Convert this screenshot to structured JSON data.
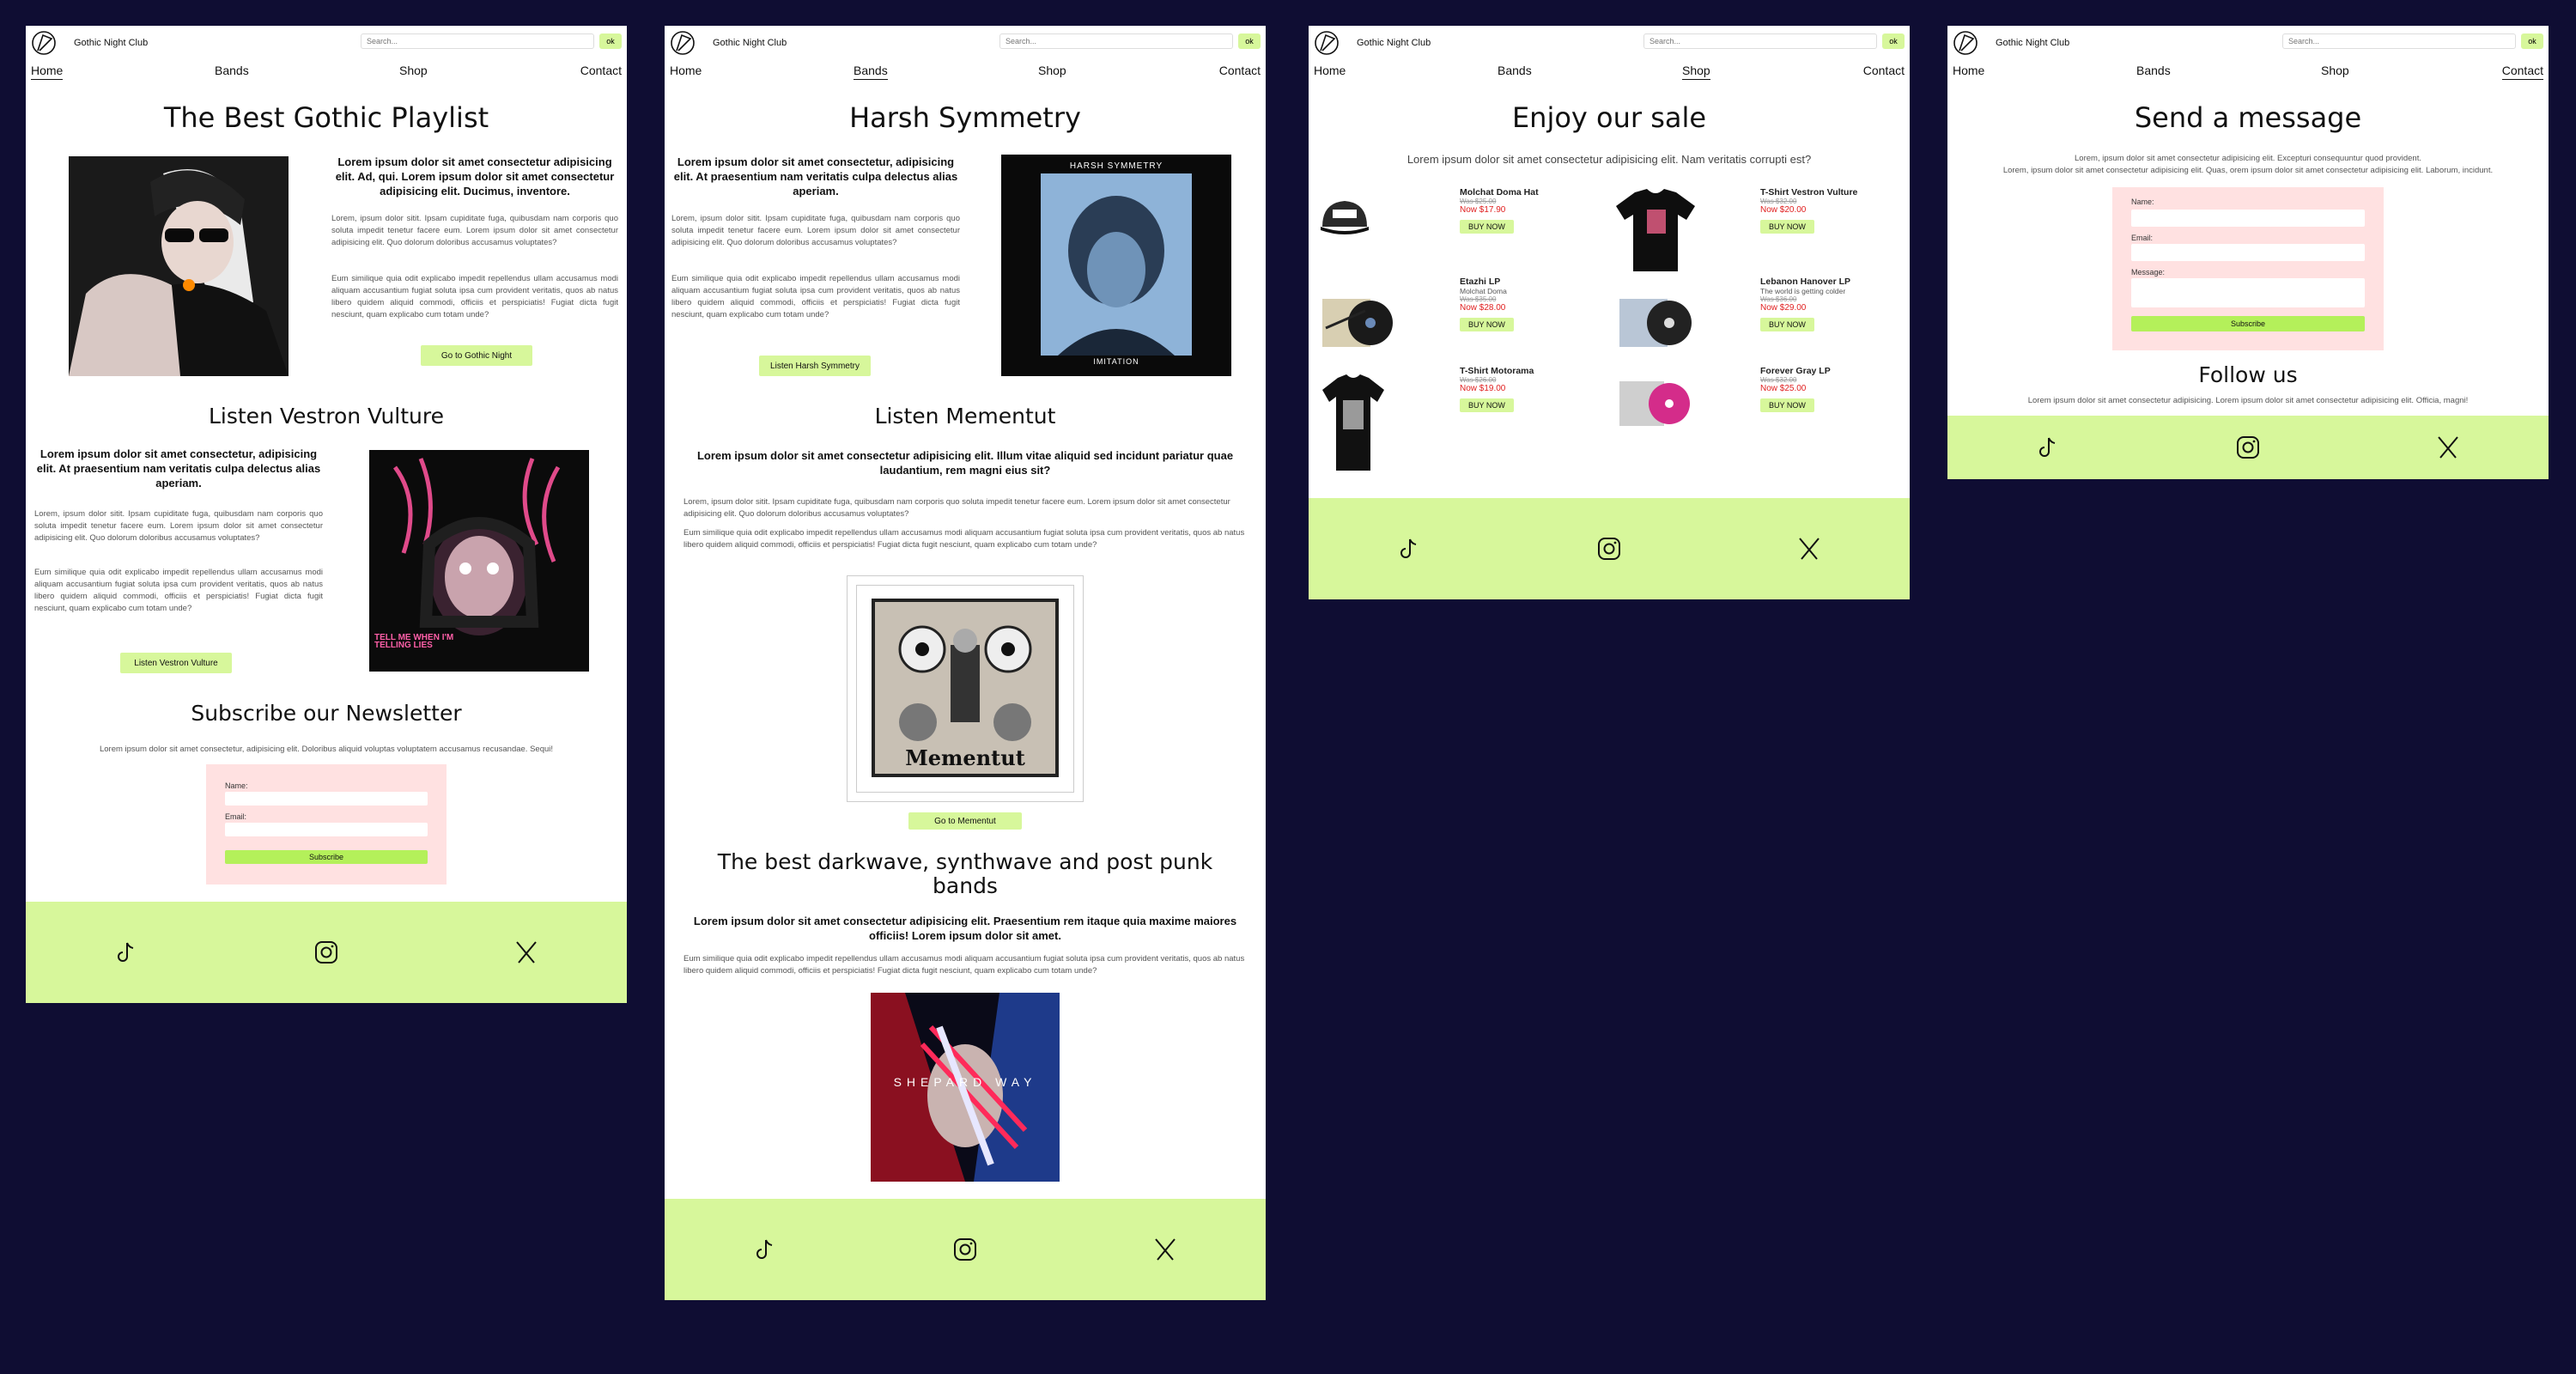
{
  "site": {
    "brand": "Gothic Night Club",
    "search_placeholder": "Search...",
    "search_button": "ok",
    "nav": [
      "Home",
      "Bands",
      "Shop",
      "Contact"
    ]
  },
  "home": {
    "title": "The Best Gothic Playlist",
    "lead1": "Lorem ipsum dolor sit amet consectetur adipisicing elit. Ad, qui. Lorem ipsum dolor sit amet consectetur adipisicing elit. Ducimus, inventore.",
    "p1": "Lorem, ipsum dolor sitit. Ipsam cupiditate fuga, quibusdam nam corporis quo soluta impedit tenetur facere eum. Lorem ipsum dolor sit amet consectetur adipisicing elit. Quo dolorum doloribus accusamus voluptates?",
    "p2": "Eum similique quia odit explicabo impedit repellendus ullam accusamus modi aliquam accusantium fugiat soluta ipsa cum provident veritatis, quos ab natus libero quidem aliquid commodi, officiis et perspiciatis! Fugiat dicta fugit nesciunt, quam explicabo cum totam unde?",
    "btn1": "Go to Gothic Night",
    "h2": "Listen Vestron Vulture",
    "lead2": "Lorem ipsum dolor sit amet consectetur, adipisicing elit. At praesentium nam veritatis culpa delectus alias aperiam.",
    "p3": "Lorem, ipsum dolor sitit. Ipsam cupiditate fuga, quibusdam nam corporis quo soluta impedit tenetur facere eum. Lorem ipsum dolor sit amet consectetur adipisicing elit. Quo dolorum doloribus accusamus voluptates?",
    "p4": "Eum similique quia odit explicabo impedit repellendus ullam accusamus modi aliquam accusantium fugiat soluta ipsa cum provident veritatis, quos ab natus libero quidem aliquid commodi, officiis et perspiciatis! Fugiat dicta fugit nesciunt, quam explicabo cum totam unde?",
    "btn2": "Listen Vestron Vulture",
    "album_text": "TELL ME WHEN I'M TELLING LIES",
    "h3": "Subscribe our Newsletter",
    "p5": "Lorem ipsum dolor sit amet consectetur, adipisicing elit. Doloribus aliquid voluptas voluptatem accusamus recusandae. Sequi!",
    "name_label": "Name:",
    "email_label": "Email:",
    "subscribe": "Subscribe"
  },
  "bands": {
    "title": "Harsh Symmetry",
    "lead1": "Lorem ipsum dolor sit amet consectetur, adipisicing elit. At praesentium nam veritatis culpa delectus alias aperiam.",
    "p1": "Lorem, ipsum dolor sitit. Ipsam cupiditate fuga, quibusdam nam corporis quo soluta impedit tenetur facere eum. Lorem ipsum dolor sit amet consectetur adipisicing elit. Quo dolorum doloribus accusamus voluptates?",
    "p2": "Eum similique quia odit explicabo impedit repellendus ullam accusamus modi aliquam accusantium fugiat soluta ipsa cum provident veritatis, quos ab natus libero quidem aliquid commodi, officiis et perspiciatis! Fugiat dicta fugit nesciunt, quam explicabo cum totam unde?",
    "btn1": "Listen Harsh Symmetry",
    "cover1_top": "HARSH SYMMETRY",
    "cover1_bottom": "IMITATION",
    "h2": "Listen Mementut",
    "lead2": "Lorem ipsum dolor sit amet consectetur adipisicing elit. Illum vitae aliquid sed incidunt pariatur quae laudantium, rem magni eius sit?",
    "p3": "Lorem, ipsum dolor sitit. Ipsam cupiditate fuga, quibusdam nam corporis quo soluta impedit tenetur facere eum. Lorem ipsum dolor sit amet consectetur adipisicing elit. Quo dolorum doloribus accusamus voluptates?",
    "p4": "Eum similique quia odit explicabo impedit repellendus ullam accusamus modi aliquam accusantium fugiat soluta ipsa cum provident veritatis, quos ab natus libero quidem aliquid commodi, officiis et perspiciatis! Fugiat dicta fugit nesciunt, quam explicabo cum totam unde?",
    "cover2_text": "Mementut",
    "btn2": "Go to Mementut",
    "h3": "The best darkwave, synthwave and post punk bands",
    "lead3": "Lorem ipsum dolor sit amet consectetur adipisicing elit. Praesentium rem itaque quia maxime maiores officiis! Lorem ipsum dolor sit amet.",
    "p5": "Eum similique quia odit explicabo impedit repellendus ullam accusamus modi aliquam accusantium fugiat soluta ipsa cum provident veritatis, quos ab natus libero quidem aliquid commodi, officiis et perspiciatis! Fugiat dicta fugit nesciunt, quam explicabo cum totam unde?",
    "cover3_text": "SHEPARD WAY"
  },
  "shop": {
    "title": "Enjoy our sale",
    "subtitle": "Lorem ipsum dolor sit amet consectetur adipisicing elit. Nam veritatis corrupti est?",
    "buy": "BUY NOW",
    "products": [
      {
        "name": "Molchat Doma Hat",
        "sub": "",
        "was": "Was $25.00",
        "now": "Now $17.90"
      },
      {
        "name": "T-Shirt Vestron Vulture",
        "sub": "",
        "was": "Was $32.00",
        "now": "Now $20.00"
      },
      {
        "name": "Etazhi LP",
        "sub": "Molchat Doma",
        "was": "Was $35.00",
        "now": "Now $28.00"
      },
      {
        "name": "Lebanon Hanover LP",
        "sub": "The world is getting colder",
        "was": "Was $36.00",
        "now": "Now $29.00"
      },
      {
        "name": "T-Shirt Motorama",
        "sub": "",
        "was": "Was $26.00",
        "now": "Now $19.00"
      },
      {
        "name": "Forever Gray LP",
        "sub": "",
        "was": "Was $32.00",
        "now": "Now $25.00"
      }
    ]
  },
  "contact": {
    "title": "Send a message",
    "p1": "Lorem, ipsum dolor sit amet consectetur adipisicing elit. Excepturi consequuntur quod provident.",
    "p2": "Lorem, ipsum dolor sit amet consectetur adipisicing elit. Quas, orem ipsum dolor sit amet consectetur adipisicing elit. Laborum, incidunt.",
    "name_label": "Name:",
    "email_label": "Email:",
    "message_label": "Message:",
    "subscribe": "Subscribe",
    "follow": "Follow us",
    "follow_text": "Lorem ipsum dolor sit amet consectetur adipisicing. Lorem ipsum dolor sit amet consectetur adipisicing elit. Officia, magni!"
  },
  "colors": {
    "accent": "#d7f79b",
    "form_bg": "#ffe1e1",
    "sale": "#e02020",
    "backdrop": "#0f0d33"
  }
}
